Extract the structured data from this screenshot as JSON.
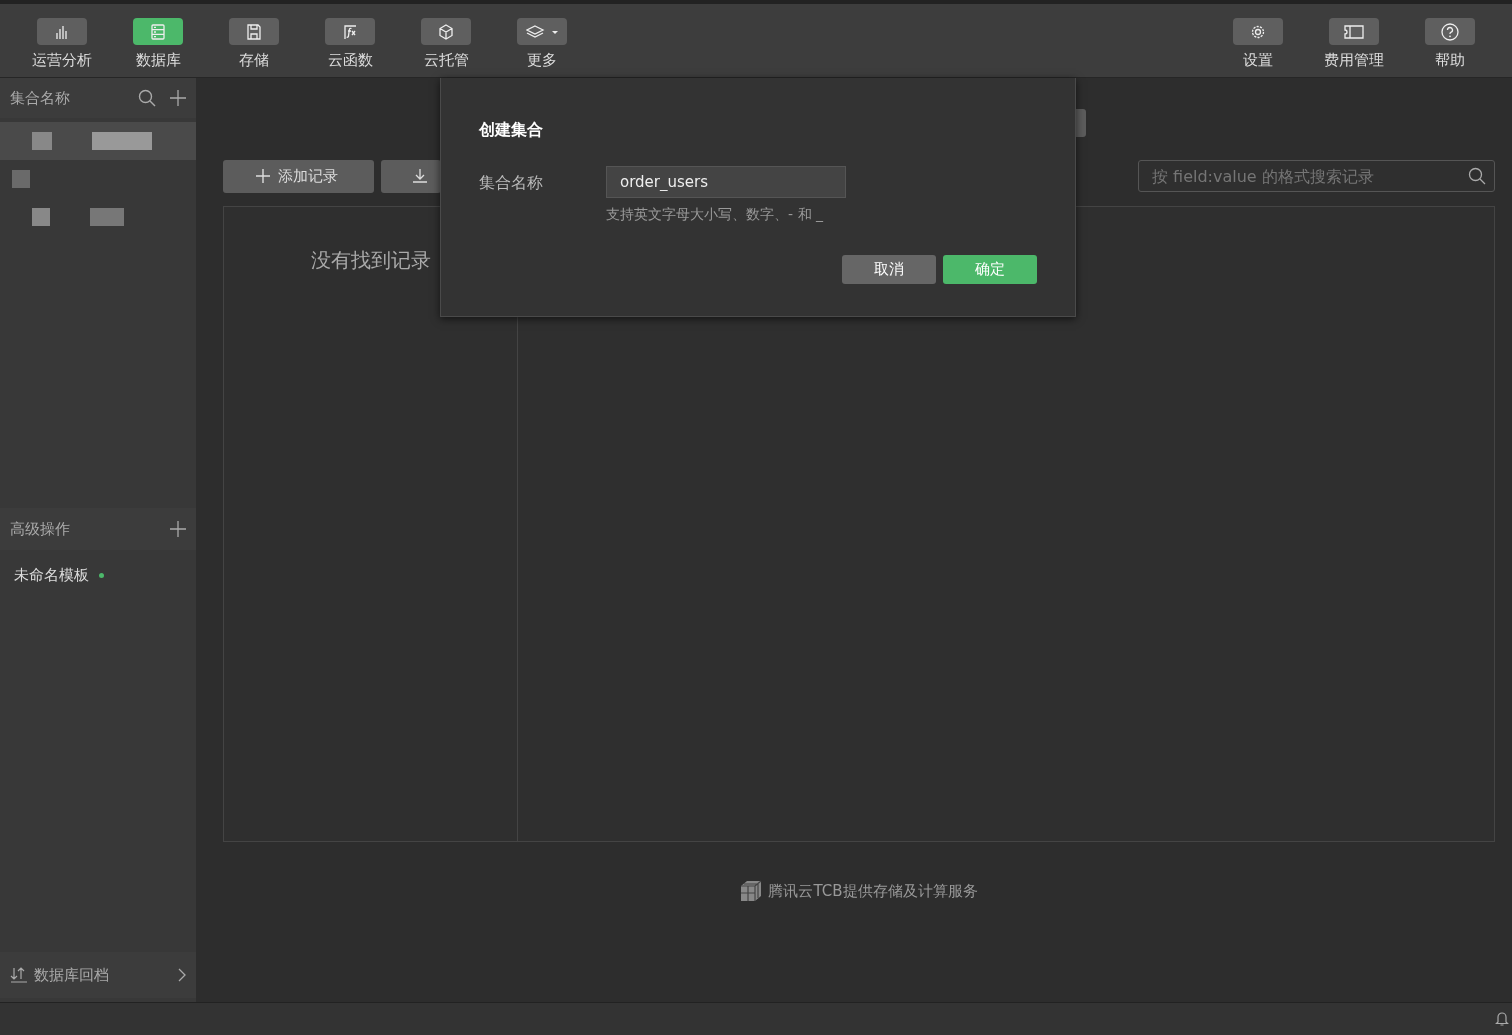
{
  "toolbar": {
    "left": [
      {
        "label": "运营分析",
        "selected": false
      },
      {
        "label": "数据库",
        "selected": true
      },
      {
        "label": "存储",
        "selected": false
      },
      {
        "label": "云函数",
        "selected": false
      },
      {
        "label": "云托管",
        "selected": false
      },
      {
        "label": "更多",
        "selected": false
      }
    ],
    "right": [
      {
        "label": "设置",
        "selected": false
      },
      {
        "label": "费用管理",
        "selected": false
      },
      {
        "label": "帮助",
        "selected": false
      }
    ]
  },
  "sidebar": {
    "collections_header": "集合名称",
    "collections": [
      {
        "selected": true
      },
      {
        "selected": false
      },
      {
        "selected": false
      }
    ],
    "advanced_header": "高级操作",
    "templates": [
      {
        "label": "未命名模板",
        "modified": true
      }
    ],
    "rollback": "数据库回档"
  },
  "main": {
    "add_button": "添加记录",
    "search": {
      "placeholder": "按 field:value 的格式搜索记录"
    },
    "empty_text": "没有找到记录",
    "footer": "腾讯云TCB提供存储及计算服务"
  },
  "dialog": {
    "title": "创建集合",
    "field_label": "集合名称",
    "value": "order_users",
    "hint": "支持英文字母大小写、数字、- 和 _",
    "buttons": [
      {
        "label": "取消",
        "kind": "secondary"
      },
      {
        "label": "确定",
        "kind": "primary"
      }
    ]
  }
}
